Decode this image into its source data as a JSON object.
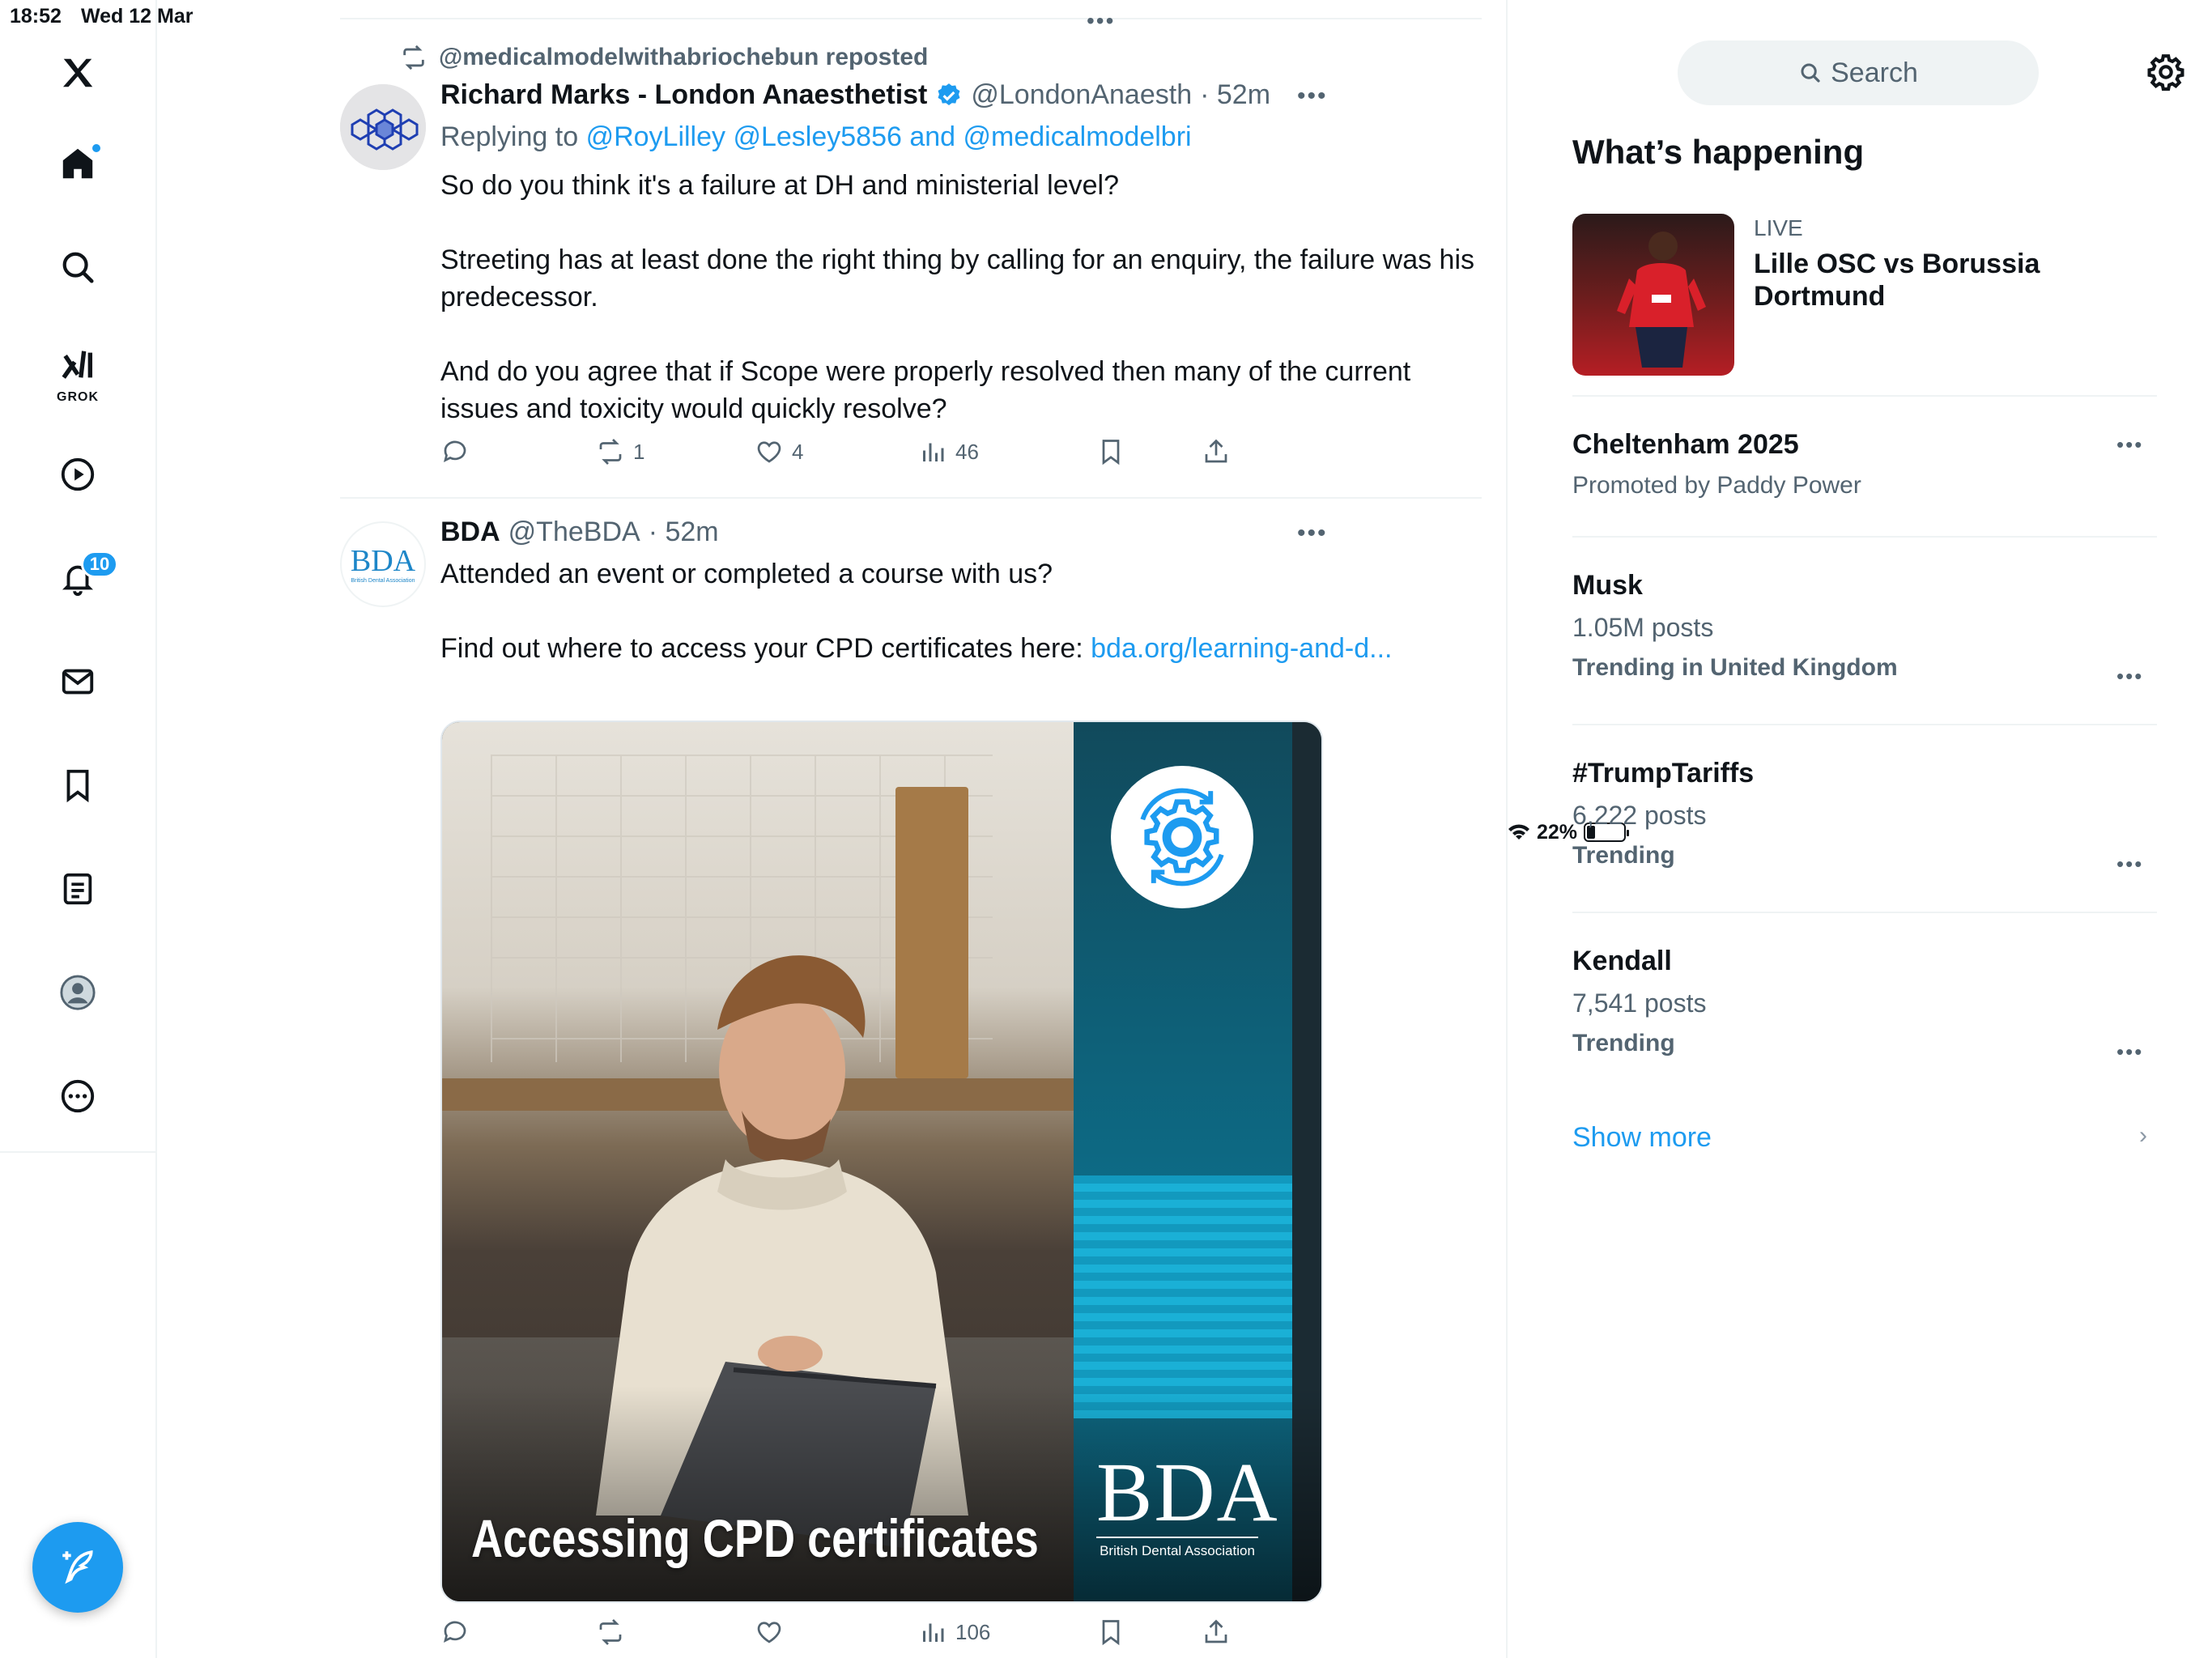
{
  "status_bar": {
    "time": "18:52",
    "date": "Wed 12 Mar",
    "battery_percent": "22%",
    "battery_level": 0.22
  },
  "nav": {
    "items": [
      {
        "name": "x-logo",
        "icon": "x-logo-icon"
      },
      {
        "name": "home",
        "icon": "home-icon",
        "has_dot": true
      },
      {
        "name": "explore",
        "icon": "search-icon"
      },
      {
        "name": "grok",
        "icon": "grok-icon",
        "label": "GROK"
      },
      {
        "name": "video",
        "icon": "play-icon"
      },
      {
        "name": "notifications",
        "icon": "bell-icon",
        "badge": "10"
      },
      {
        "name": "messages",
        "icon": "mail-icon"
      },
      {
        "name": "bookmarks",
        "icon": "bookmark-icon"
      },
      {
        "name": "lists",
        "icon": "list-icon"
      },
      {
        "name": "profile",
        "icon": "avatar-icon"
      },
      {
        "name": "more",
        "icon": "more-circle-icon"
      }
    ],
    "compose_icon": "compose-icon"
  },
  "timeline": {
    "tweets": [
      {
        "repost_by": "@medicalmodelwithabriochebun reposted",
        "name": "Richard Marks - London Anaesthetist",
        "verified": true,
        "handle": "@LondonAnaesth",
        "time": "· 52m",
        "reply_prefix": "Replying to",
        "reply_targets": "@RoyLilley @Lesley5856 and @medicalmodelbri",
        "text": [
          "So do you think it's a failure at DH and ministerial level?",
          "Streeting has at least done the right thing by calling for an enquiry, the failure was his predecessor.",
          "And do you agree that if Scope were properly resolved then many of the current issues and toxicity would quickly resolve?"
        ],
        "actions": {
          "replies": "",
          "reposts": "1",
          "likes": "4",
          "views": "46"
        }
      },
      {
        "name": "BDA",
        "handle": "@TheBDA",
        "time": "· 52m",
        "avatar_text": "BDA",
        "avatar_subtext": "British Dental Association",
        "text_line1": "Attended an event or completed a course with us?",
        "text_line2_prefix": "Find out where to access your CPD certificates here:",
        "link": "bda.org/learning-and-d...",
        "media": {
          "caption": "Accessing CPD certificates",
          "logo_big": "BDA",
          "logo_small": "British Dental Association"
        },
        "actions": {
          "replies": "",
          "reposts": "",
          "likes": "",
          "views": "106"
        }
      }
    ]
  },
  "sidebar": {
    "search_placeholder": "Search",
    "section_title": "What’s happening",
    "live": {
      "tag": "LIVE",
      "title": "Lille OSC vs Borussia Dortmund"
    },
    "promoted": {
      "title": "Cheltenham 2025",
      "sub": "Promoted by Paddy Power"
    },
    "trends": [
      {
        "title": "Musk",
        "posts": "1.05M posts",
        "meta": "Trending in United Kingdom"
      },
      {
        "title": "#TrumpTariffs",
        "posts": "6,222 posts",
        "meta": "Trending"
      },
      {
        "title": "Kendall",
        "posts": "7,541 posts",
        "meta": "Trending"
      }
    ],
    "show_more": "Show more"
  },
  "colors": {
    "accent": "#1d9bf0",
    "text": "#0f1419",
    "secondary": "#536471",
    "border": "#eff3f4"
  }
}
